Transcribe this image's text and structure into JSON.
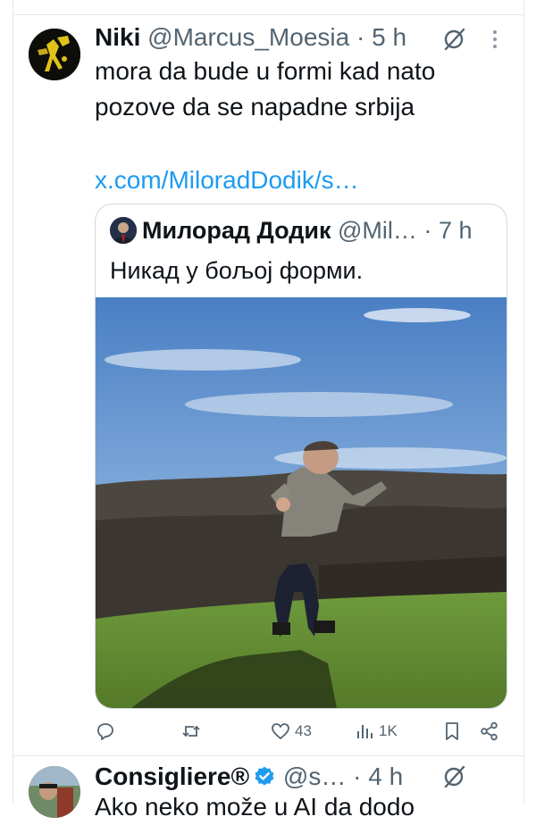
{
  "tweet": {
    "author_name": "Niki",
    "author_handle": "@Marcus_Moesia",
    "separator": "·",
    "time": "5 h",
    "text_lines": [
      "mora da bude u formi kad nato",
      "pozove da se napadne srbija"
    ],
    "link": "x.com/MiloradDodik/s…",
    "avatar_icon": "avatar-yellow-figure"
  },
  "quote": {
    "author_name": "Милорад Додик",
    "author_handle": "@Mil…",
    "separator": "·",
    "time": "7 h",
    "text": "Никад у бољој форми.",
    "media": "video",
    "mute_icon": "speaker-muted-icon"
  },
  "actions": {
    "reply_icon": "reply-icon",
    "repost_icon": "repost-icon",
    "like_icon": "heart-icon",
    "like_count": "43",
    "views_icon": "views-icon",
    "views_count": "1K",
    "bookmark_icon": "bookmark-icon",
    "share_icon": "share-icon"
  },
  "next_tweet": {
    "author_name": "Consigliere®",
    "author_handle": "@s…",
    "separator": "·",
    "time": "4 h",
    "text_partial": "Ako neko može u AI da dodo",
    "verified_icon": "verified-badge-icon"
  },
  "colors": {
    "text": "#0f1419",
    "secondary": "#536471",
    "link": "#1d9bf0",
    "border": "#cfd9de",
    "divider": "#e4e8eb"
  }
}
